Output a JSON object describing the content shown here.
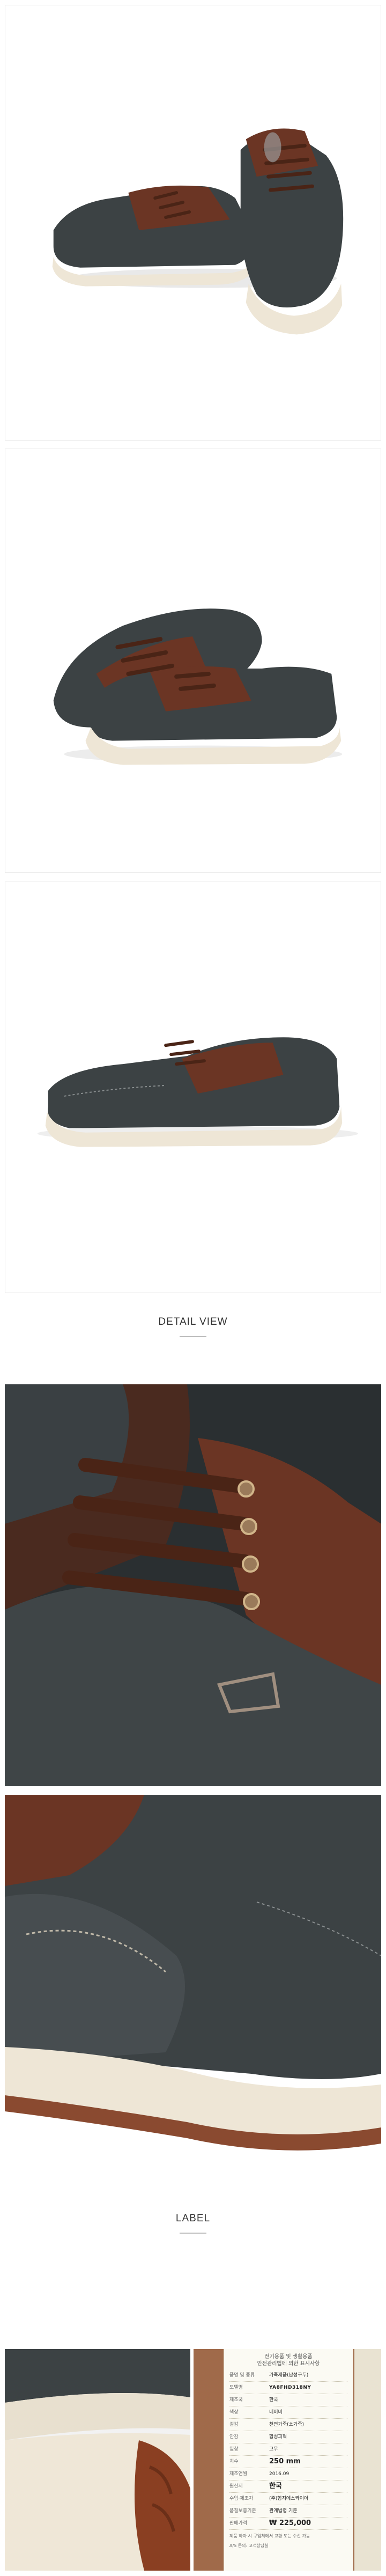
{
  "sections": {
    "detail_view": "DETAIL VIEW",
    "label": "LABEL"
  },
  "tag": {
    "header_line1": "전기용품 및 생활용품",
    "header_line2": "안전관리법에 의한 표시사항",
    "rows": [
      {
        "key": "품명 및 종류",
        "value": "가죽제품(남성구두)"
      },
      {
        "key": "모델명",
        "value": "YA8FHD318NY"
      },
      {
        "key": "제조국",
        "value": "한국"
      },
      {
        "key": "색상",
        "value": "네이비"
      },
      {
        "key": "겉감",
        "value": "천연가죽(소가죽)"
      },
      {
        "key": "안감",
        "value": "합성피혁"
      },
      {
        "key": "밑창",
        "value": "고무"
      },
      {
        "key": "치수",
        "value": "250 mm"
      },
      {
        "key": "제조연월",
        "value": "2016.09"
      },
      {
        "key": "원산지",
        "value": "한국"
      },
      {
        "key": "수입·제조자",
        "value": "(주)형지에스콰이아"
      },
      {
        "key": "품질보증기준",
        "value": "관계법령 기준"
      },
      {
        "key": "판매가격",
        "value": "₩ 225,000"
      }
    ],
    "foot_line1": "제품 하자 시 구입처에서 교환 또는 수선 가능",
    "foot_line2": "A/S 문의: 고객상담실"
  },
  "colors": {
    "leather_dark": "#3c4244",
    "leather_brown": "#6b3524",
    "sole": "#eee6d6",
    "lace": "#4a2416"
  }
}
